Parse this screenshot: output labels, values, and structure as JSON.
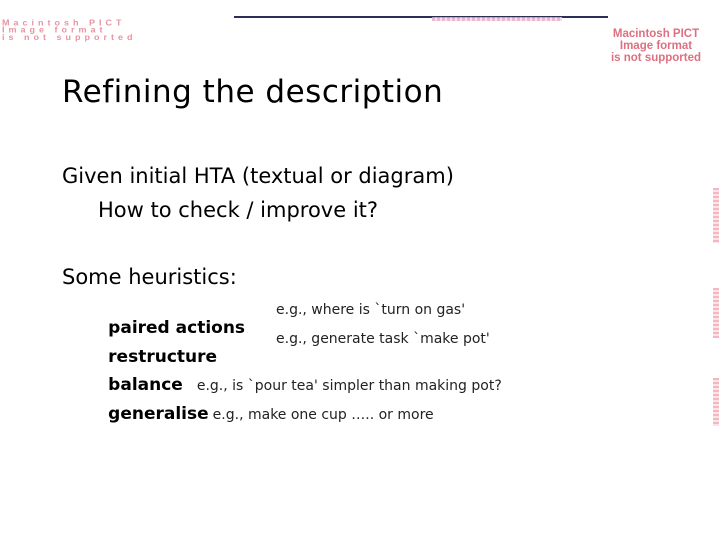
{
  "placeholders": {
    "top_left": "Macintosh PICT\nImage format\nis not supported",
    "right": [
      "Macintosh PICT",
      "Image format",
      "is not supported"
    ]
  },
  "slide": {
    "title": "Refining the description",
    "intro": "Given initial HTA (textual or diagram)",
    "question": "How to check / improve it?",
    "heuristics_label": "Some heuristics:",
    "heuristics": [
      {
        "term": "paired actions",
        "example": "e.g., where is `turn on gas'"
      },
      {
        "term": "restructure",
        "example": "e.g., generate task `make pot'"
      },
      {
        "term": "balance",
        "example": "e.g., is `pour tea' simpler than making pot?"
      },
      {
        "term": "generalise",
        "example": "e.g., make one cup ….. or more"
      }
    ]
  },
  "colors": {
    "rule": "#2b2e57",
    "placeholder_text": "#d9566a"
  }
}
